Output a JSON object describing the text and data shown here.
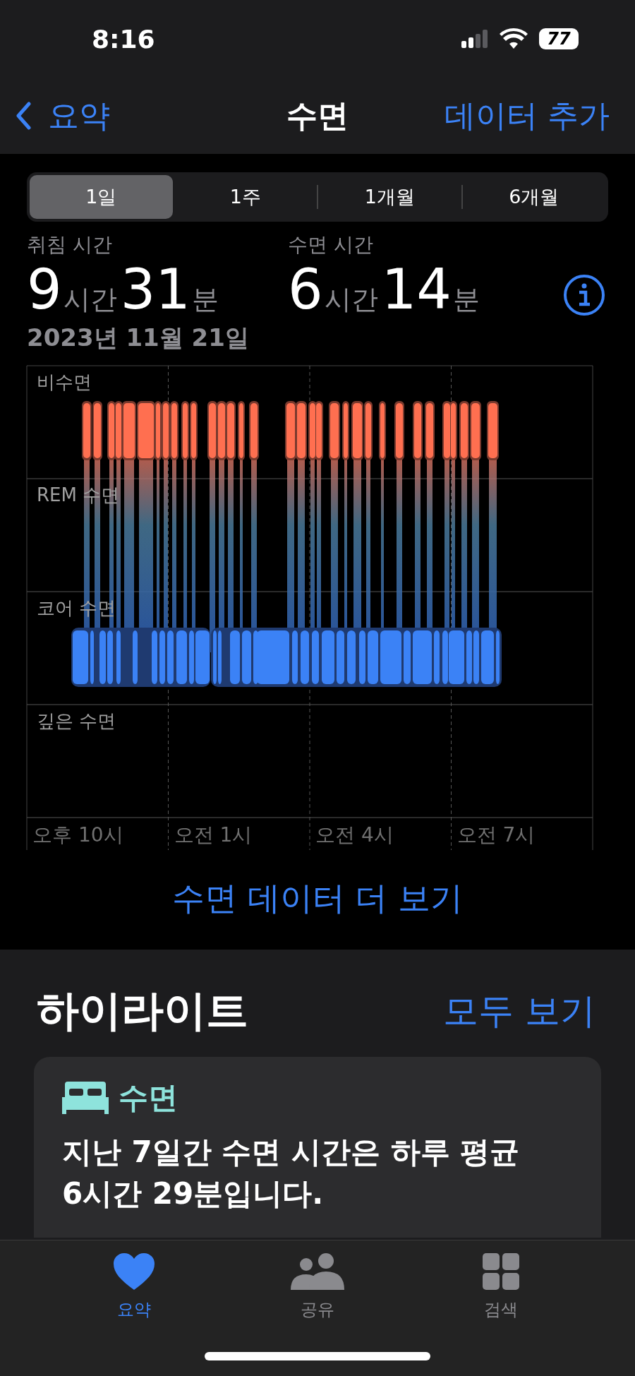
{
  "status_bar": {
    "time": "8:16",
    "battery": "77"
  },
  "nav": {
    "back": "요약",
    "title": "수면",
    "action": "데이터 추가"
  },
  "segments": [
    {
      "label": "1일",
      "selected": true
    },
    {
      "label": "1주",
      "selected": false
    },
    {
      "label": "1개월",
      "selected": false
    },
    {
      "label": "6개월",
      "selected": false
    }
  ],
  "stats": [
    {
      "label": "취침 시간",
      "hours": "9",
      "hours_unit": "시간",
      "minutes": "31",
      "minutes_unit": "분"
    },
    {
      "label": "수면 시간",
      "hours": "6",
      "hours_unit": "시간",
      "minutes": "14",
      "minutes_unit": "분"
    }
  ],
  "date": "2023년 11월 21일",
  "chart": {
    "stages": [
      "비수면",
      "REM 수면",
      "코어 수면",
      "깊은 수면"
    ],
    "times": [
      "오후 10시",
      "오전 1시",
      "오전 4시",
      "오전 7시"
    ]
  },
  "more_link": "수면 데이터 더 보기",
  "highlights": {
    "title": "하이라이트",
    "see_all": "모두 보기",
    "card": {
      "category": "수면",
      "text": "지난 7일간 수면 시간은 하루 평균 6시간 29분입니다."
    }
  },
  "tab_bar": [
    {
      "label": "요약",
      "kind": "heart",
      "selected": true
    },
    {
      "label": "공유",
      "kind": "people",
      "selected": false
    },
    {
      "label": "검색",
      "kind": "grid",
      "selected": false
    }
  ]
}
